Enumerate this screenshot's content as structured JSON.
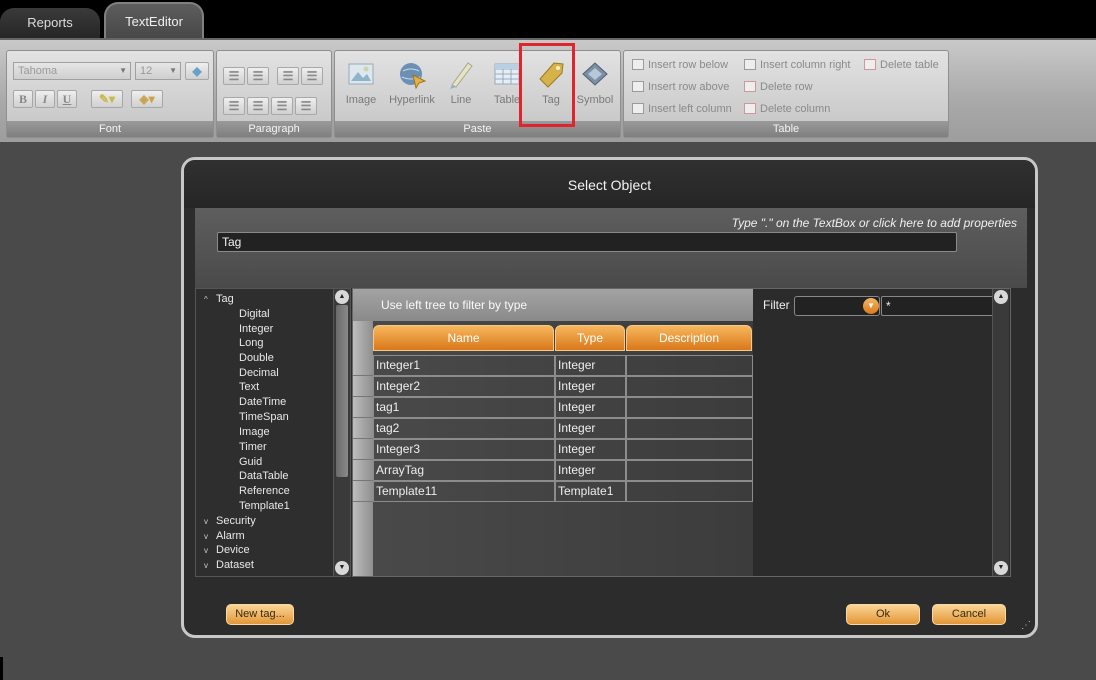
{
  "tabs": [
    {
      "label": "Reports",
      "active": false
    },
    {
      "label": "TextEditor",
      "active": true
    }
  ],
  "ribbon": {
    "font": {
      "label": "Font",
      "family": "Tahoma",
      "size": "12",
      "bold": "B",
      "italic": "I",
      "underline": "U"
    },
    "paragraph": {
      "label": "Paragraph"
    },
    "paste": {
      "label": "Paste",
      "buttons": [
        {
          "label": "Image",
          "icon": "image-icon"
        },
        {
          "label": "Hyperlink",
          "icon": "hyperlink-icon"
        },
        {
          "label": "Line",
          "icon": "line-icon"
        },
        {
          "label": "Table",
          "icon": "table-icon"
        },
        {
          "label": "Tag",
          "icon": "tag-icon"
        },
        {
          "label": "Symbol",
          "icon": "symbol-icon"
        }
      ]
    },
    "table": {
      "label": "Table",
      "col1": [
        "Insert row below",
        "Insert row above",
        "Insert left column"
      ],
      "col2": [
        "Insert column right",
        "Delete row",
        "Delete column"
      ],
      "col3": [
        "Delete table"
      ]
    }
  },
  "dialog": {
    "title": "Select Object",
    "hint": "Type \".\" on the TextBox or click here to add properties",
    "input_value": "Tag",
    "tree": {
      "root": "Tag",
      "children": [
        "Digital",
        "Integer",
        "Long",
        "Double",
        "Decimal",
        "Text",
        "DateTime",
        "TimeSpan",
        "Image",
        "Timer",
        "Guid",
        "DataTable",
        "Reference",
        "Template1"
      ],
      "collapsed": [
        "Security",
        "Alarm",
        "Device",
        "Dataset"
      ]
    },
    "grid": {
      "bar_text": "Use left tree to filter by type",
      "columns": [
        "Name",
        "Type",
        "Description"
      ],
      "rows": [
        [
          "Integer1",
          "Integer",
          ""
        ],
        [
          "Integer2",
          "Integer",
          ""
        ],
        [
          "tag1",
          "Integer",
          ""
        ],
        [
          "tag2",
          "Integer",
          ""
        ],
        [
          "Integer3",
          "Integer",
          ""
        ],
        [
          "ArrayTag",
          "Integer",
          ""
        ],
        [
          "Template11",
          "Template1",
          ""
        ]
      ]
    },
    "filter": {
      "label": "Filter",
      "combo_value": "",
      "text_value": "*"
    },
    "buttons": {
      "new_tag": "New tag...",
      "ok": "Ok",
      "cancel": "Cancel"
    }
  },
  "colors": {
    "accent_orange": "#e8922f",
    "highlight_red": "#e0242d"
  }
}
